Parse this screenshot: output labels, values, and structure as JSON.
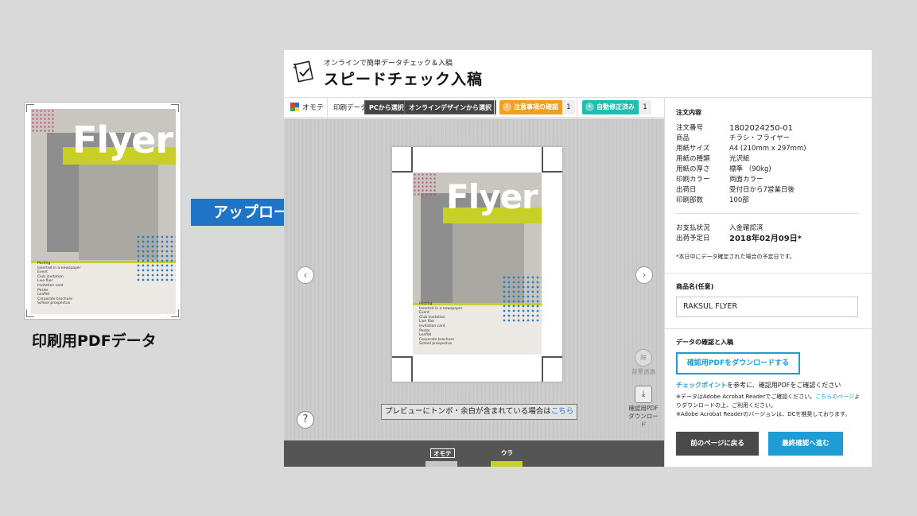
{
  "left": {
    "caption": "印刷用PDFデータ",
    "flyer_word": "Flyer",
    "flyer_list": [
      "Posting",
      "Inserted in a newspaper",
      "Event",
      "Club invitation",
      "Live flier",
      "Invitation card",
      "Poster",
      "Leaflet",
      "Corporate brochure",
      "School prospectus"
    ]
  },
  "arrow": {
    "label": "アップロード",
    "color": "#1e74c7"
  },
  "app": {
    "subtitle": "オンラインで簡単データチェック＆入稿",
    "title": "スピードチェック入稿",
    "toolbar": {
      "side_tab": "オモテ",
      "print_data_label": "印刷データ",
      "pc_select": "PCから選択",
      "online_select": "オンラインデザインから選択",
      "warning_chip": "注意事項の確認",
      "warning_count": "1",
      "auto_fix_chip": "自動修正済み",
      "auto_fix_count": "1",
      "warning_color": "#f0a020",
      "auto_fix_color": "#1fbfb0"
    },
    "preview": {
      "flyer_word": "Flyer",
      "flyer_list": [
        "Posting",
        "Inserted in a newspaper",
        "Event",
        "Club invitation",
        "Live flier",
        "Invitation card",
        "Poster",
        "Leaflet",
        "Corporate brochure",
        "School prospectus"
      ],
      "tool1_label": "背景透過",
      "tool2_label": "確認用PDF ダウンロード",
      "note_text": "プレビューにトンボ・余白が含まれている場合は",
      "note_link": "こちら",
      "thumb_front": "オモテ",
      "thumb_back": "ウラ"
    },
    "side": {
      "order_title": "注文内容",
      "order": [
        {
          "k": "注文番号",
          "v": "1802024250-01"
        },
        {
          "k": "商品",
          "v": "チラシ・フライヤー"
        },
        {
          "k": "用紙サイズ",
          "v": "A4 (210mm x 297mm)"
        },
        {
          "k": "用紙の種類",
          "v": "光沢紙"
        },
        {
          "k": "用紙の厚さ",
          "v": "標準 （90kg)"
        },
        {
          "k": "印刷カラー",
          "v": "両面カラー"
        },
        {
          "k": "出荷日",
          "v": "受付日から7営業日後"
        },
        {
          "k": "印刷部数",
          "v": "100部"
        }
      ],
      "payment_k": "お支払状況",
      "payment_v": "入金確認済",
      "ship_k": "出荷予定日",
      "ship_v": "2018年02月09日*",
      "ship_note": "*本日中にデータ確定された場合の予定日です。",
      "name_title": "商品名(任意)",
      "name_value": "RAKSUL FLYER",
      "check_title": "データの確認と入稿",
      "download_btn": "確認用PDFをダウンロードする",
      "checkpoint_link": "チェックポイント",
      "checkpoint_text": "を参考に、確認用PDFをご確認ください",
      "note1a": "※データはAdobe Acrobat Readerでご確認ください。",
      "note1_link": "こちらのページ",
      "note1b": "よりダウンロードの上、ご利用ください。",
      "note2": "※Adobe Acrobat Readerのバージョンは、DCを推奨しております。",
      "back_btn": "前のページに戻る",
      "next_btn": "最終確認へ進む"
    }
  }
}
